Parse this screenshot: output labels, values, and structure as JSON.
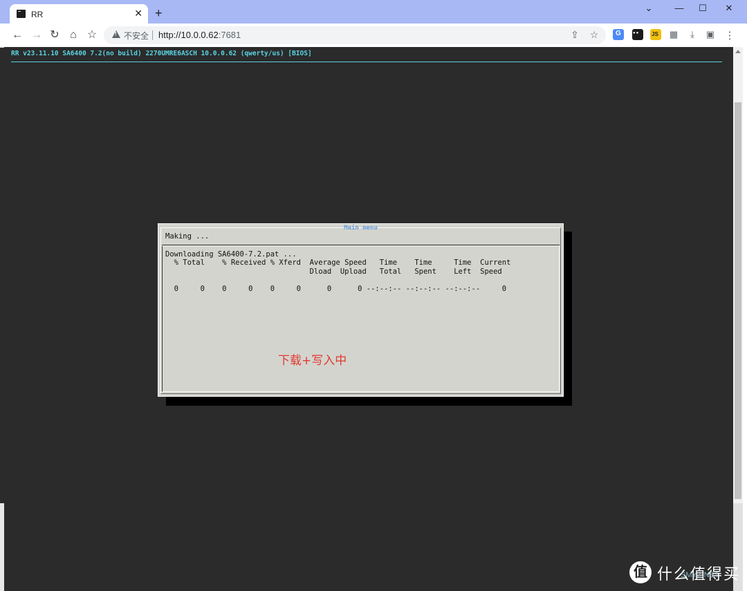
{
  "browser": {
    "tab_title": "RR",
    "tab_close": "✕",
    "new_tab": "+",
    "win_chevron": "⌄",
    "win_minimize": "—",
    "win_maximize": "☐",
    "win_close": "✕"
  },
  "toolbar": {
    "back": "←",
    "forward": "→",
    "reload": "↻",
    "home": "⌂",
    "bookmark": "☆",
    "security_label": "不安全",
    "url_host": "http://10.0.0.62",
    "url_port": ":7681",
    "share": "⇪",
    "star": "☆",
    "puzzle": "▦",
    "download": "⤓",
    "sidepanel": "▣",
    "menu": "⋮"
  },
  "terminal": {
    "header": "RR v23.11.10 SA6400 7.2(no build) 2270UMRE6ASCH 10.0.0.62 (qwerty/us) [BIOS]"
  },
  "dialog": {
    "title": "Main menu",
    "status": "Making ...",
    "lines": [
      "Downloading SA6400-7.2.pat ...",
      "  % Total    % Received % Xferd  Average Speed   Time    Time     Time  Current",
      "                                 Dload  Upload   Total   Spent    Left  Speed",
      "",
      "  0     0    0     0    0     0      0      0 --:--:-- --:--:-- --:--:--     0"
    ]
  },
  "annotation": "下载+写入中",
  "watermark": {
    "logo_char": "值",
    "text": "什么值得买",
    "small": "SMYZ.NET"
  }
}
